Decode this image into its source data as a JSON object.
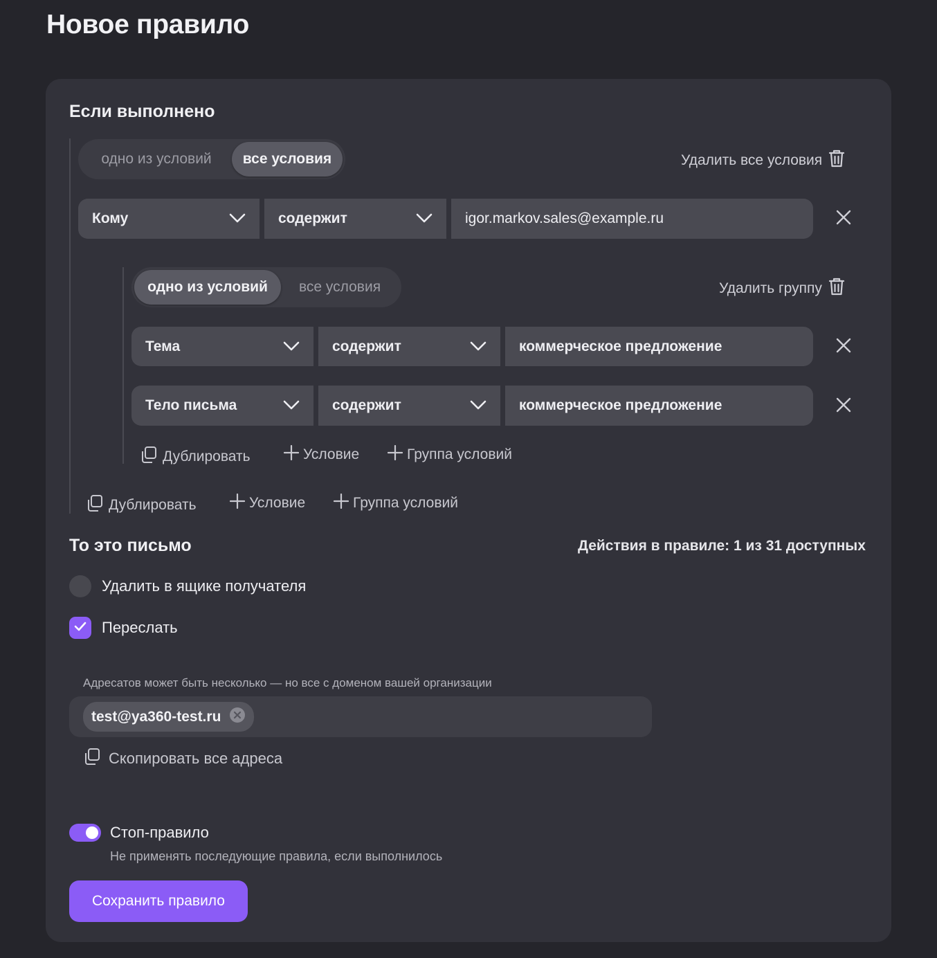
{
  "page": {
    "title": "Новое правило"
  },
  "conditions": {
    "heading": "Если выполнено",
    "mode": {
      "options": [
        "одно из условий",
        "все условия"
      ],
      "selected": "все условия"
    },
    "delete_all_label": "Удалить все условия",
    "rows": [
      {
        "field": "Кому",
        "operator": "содержит",
        "value": "igor.markov.sales@example.ru"
      }
    ],
    "group": {
      "mode": {
        "options": [
          "одно из условий",
          "все условия"
        ],
        "selected": "одно из условий"
      },
      "delete_label": "Удалить группу",
      "rows": [
        {
          "field": "Тема",
          "operator": "содержит",
          "value": "коммерческое предложение"
        },
        {
          "field": "Тело письма",
          "operator": "содержит",
          "value": "коммерческое предложение"
        }
      ],
      "actions": {
        "duplicate": "Дублировать",
        "add_condition": "Условие",
        "add_group": "Группа условий"
      }
    },
    "actions": {
      "duplicate": "Дублировать",
      "add_condition": "Условие",
      "add_group": "Группа условий"
    }
  },
  "actions_section": {
    "heading": "То это письмо",
    "counter": "Действия в правиле: 1 из 31 доступных",
    "delete_option": {
      "label": "Удалить в ящике получателя",
      "checked": false
    },
    "forward_option": {
      "label": "Переслать",
      "checked": true
    },
    "forward_hint": "Адресатов может быть несколько — но все с доменом вашей организации",
    "recipients": [
      "test@ya360-test.ru"
    ],
    "copy_all_label": "Скопировать все адреса"
  },
  "stop_rule": {
    "label": "Стоп-правило",
    "description": "Не применять последующие правила, если выполнилось",
    "enabled": true
  },
  "save_button": "Сохранить правило",
  "colors": {
    "accent": "#8b5cf6",
    "background": "#25252b",
    "card": "#32323a",
    "field": "#4a4a52"
  },
  "icons": [
    "trash-icon",
    "chevron-down-icon",
    "close-icon",
    "copy-icon",
    "plus-icon",
    "check-icon",
    "chip-remove-icon"
  ]
}
